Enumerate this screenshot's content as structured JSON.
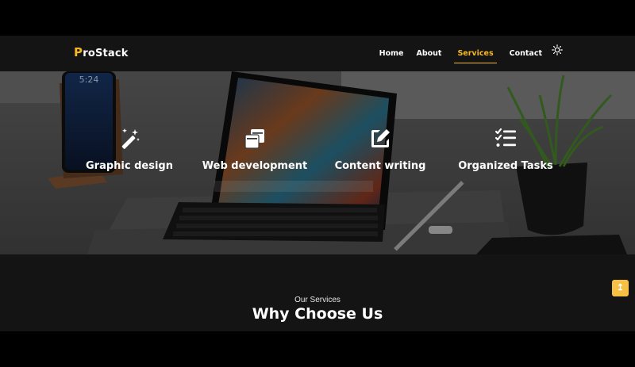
{
  "header": {
    "logo_initial": "P",
    "logo_rest": "roStack",
    "nav": [
      {
        "label": "Home"
      },
      {
        "label": "About"
      },
      {
        "label": "Services",
        "active": true
      },
      {
        "label": "Contact"
      }
    ],
    "theme_icon": "sun-icon"
  },
  "hero": {
    "services": [
      {
        "title": "Graphic design",
        "icon": "magic-wand-icon"
      },
      {
        "title": "Web development",
        "icon": "copy-windows-icon"
      },
      {
        "title": "Content writing",
        "icon": "edit-pen-icon"
      },
      {
        "title": "Organized Tasks",
        "icon": "task-list-icon"
      }
    ]
  },
  "section": {
    "subtitle": "Our Services",
    "title": "Why Choose Us"
  },
  "scroll_top": {
    "label": "↥",
    "icon": "arrow-up-icon"
  },
  "colors": {
    "accent": "#f5b820",
    "scroll_button": "#f5c043",
    "navbar_bg": "#141414",
    "page_bg": "#000000"
  }
}
